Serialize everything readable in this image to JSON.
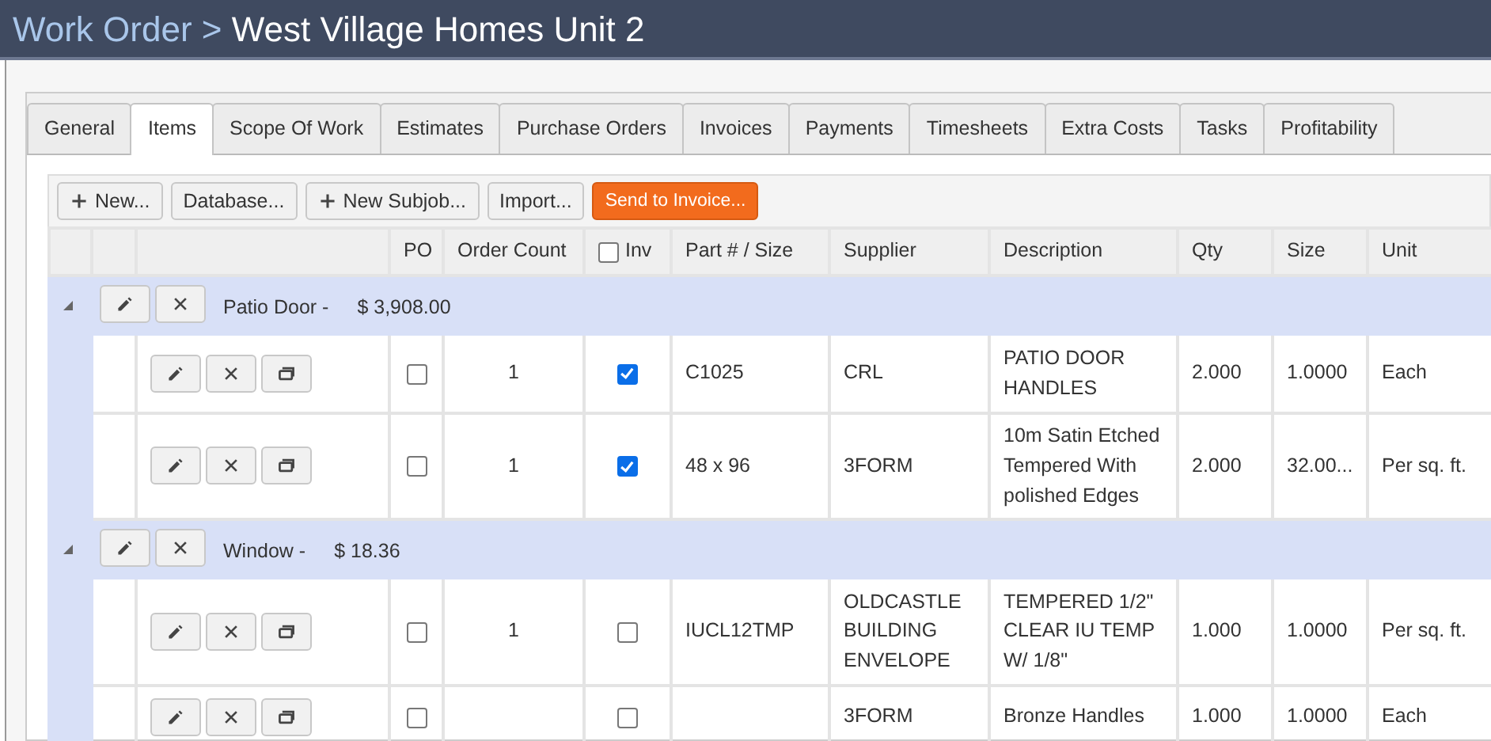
{
  "header": {
    "parent": "Work Order",
    "separator": ">",
    "title": "West Village Homes Unit 2"
  },
  "tabs": [
    {
      "label": "General",
      "selected": false
    },
    {
      "label": "Items",
      "selected": true
    },
    {
      "label": "Scope Of Work",
      "selected": false
    },
    {
      "label": "Estimates",
      "selected": false
    },
    {
      "label": "Purchase Orders",
      "selected": false
    },
    {
      "label": "Invoices",
      "selected": false
    },
    {
      "label": "Payments",
      "selected": false
    },
    {
      "label": "Timesheets",
      "selected": false
    },
    {
      "label": "Extra Costs",
      "selected": false
    },
    {
      "label": "Tasks",
      "selected": false
    },
    {
      "label": "Profitability",
      "selected": false
    }
  ],
  "toolbar": [
    {
      "label": "New...",
      "kind": "plus"
    },
    {
      "label": "Database...",
      "kind": "plain"
    },
    {
      "label": "New Subjob...",
      "kind": "plus"
    },
    {
      "label": "Import...",
      "kind": "plain"
    },
    {
      "label": "Send to Invoice...",
      "kind": "accent"
    }
  ],
  "columns": [
    {
      "label": "PO",
      "kind": "text"
    },
    {
      "label": "Order Count",
      "kind": "text"
    },
    {
      "label": "Inv",
      "kind": "checkbox",
      "checked": false
    },
    {
      "label": "Part # / Size",
      "kind": "text"
    },
    {
      "label": "Supplier",
      "kind": "text"
    },
    {
      "label": "Description",
      "kind": "text"
    },
    {
      "label": "Qty",
      "kind": "text"
    },
    {
      "label": "Size",
      "kind": "text"
    },
    {
      "label": "Unit",
      "kind": "text"
    }
  ],
  "groups": [
    {
      "name": "Patio Door -",
      "total": "$ 3,908.00",
      "expanded": true,
      "items": [
        {
          "po": false,
          "order_count": "1",
          "inv": true,
          "part": "C1025",
          "supplier": "CRL",
          "description": "PATIO DOOR HANDLES",
          "qty": "2.000",
          "size": "1.0000",
          "unit": "Each"
        },
        {
          "po": false,
          "order_count": "1",
          "inv": true,
          "part": "48 x 96",
          "supplier": "3FORM",
          "description": "10m Satin Etched Tempered With polished Edges",
          "qty": "2.000",
          "size": "32.00...",
          "unit": "Per sq. ft."
        }
      ]
    },
    {
      "name": "Window -",
      "total": "$ 18.36",
      "expanded": true,
      "items": [
        {
          "po": false,
          "order_count": "1",
          "inv": false,
          "part": "IUCL12TMP",
          "supplier": "OLDCASTLE BUILDING ENVELOPE",
          "description": "TEMPERED 1/2\" CLEAR IU TEMP W/ 1/8\"",
          "qty": "1.000",
          "size": "1.0000",
          "unit": "Per sq. ft."
        },
        {
          "po": false,
          "inv": false,
          "supplier": "3FORM",
          "description": "Bronze Handles",
          "qty": "1.000",
          "size": "1.0000",
          "unit": "Each"
        }
      ]
    }
  ]
}
